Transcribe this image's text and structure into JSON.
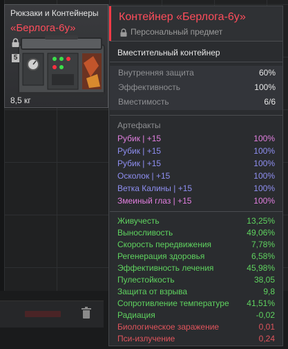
{
  "inventory": {
    "item": {
      "category": "Рюкзаки и Контейнеры",
      "name": "«Берлога-6у»",
      "level": "5",
      "weight": "8,5 кг"
    }
  },
  "tooltip": {
    "title": "Контейнер «Берлога-6у»",
    "subtitle": "Персональный предмет",
    "description": "Вместительный контейнер",
    "stats": [
      {
        "label": "Внутренняя защита",
        "value": "60%"
      },
      {
        "label": "Эффективность",
        "value": "100%"
      },
      {
        "label": "Вместимость",
        "value": "6/6"
      }
    ],
    "artifacts_header": "Артефакты",
    "artifacts": [
      {
        "label": "Рубик | +15",
        "value": "100%",
        "color": "#e27fe0"
      },
      {
        "label": "Рубик | +15",
        "value": "100%",
        "color": "#8f8ff2"
      },
      {
        "label": "Рубик | +15",
        "value": "100%",
        "color": "#8f8ff2"
      },
      {
        "label": "Осколок | +15",
        "value": "100%",
        "color": "#8f8ff2"
      },
      {
        "label": "Ветка Калины | +15",
        "value": "100%",
        "color": "#8f8ff2"
      },
      {
        "label": "Змеиный глаз | +15",
        "value": "100%",
        "color": "#e27fe0"
      }
    ],
    "effects": [
      {
        "label": "Живучесть",
        "value": "13,25%",
        "color": "#5fd35f"
      },
      {
        "label": "Выносливость",
        "value": "49,06%",
        "color": "#5fd35f"
      },
      {
        "label": "Скорость передвижения",
        "value": "7,78%",
        "color": "#5fd35f"
      },
      {
        "label": "Регенерация здоровья",
        "value": "6,58%",
        "color": "#5fd35f"
      },
      {
        "label": "Эффективность лечения",
        "value": "45,98%",
        "color": "#5fd35f"
      },
      {
        "label": "Пулестойкость",
        "value": "38,05",
        "color": "#5fd35f"
      },
      {
        "label": "Защита от взрыва",
        "value": "9,8",
        "color": "#5fd35f"
      },
      {
        "label": "Сопротивление температуре",
        "value": "41,51%",
        "color": "#5fd35f"
      },
      {
        "label": "Радиация",
        "value": "-0,02",
        "color": "#5fd35f"
      },
      {
        "label": "Биологическое заражение",
        "value": "0,01",
        "color": "#e0545c"
      },
      {
        "label": "Пси-излучение",
        "value": "0,24",
        "color": "#e0545c"
      }
    ]
  },
  "icons": {
    "lock": "lock-icon",
    "trash": "trash-icon"
  },
  "colors": {
    "accent": "#ff3b47",
    "buff": "#5fd35f",
    "debuff": "#e0545c",
    "artifact_pink": "#e27fe0",
    "artifact_blue": "#8f8ff2"
  }
}
